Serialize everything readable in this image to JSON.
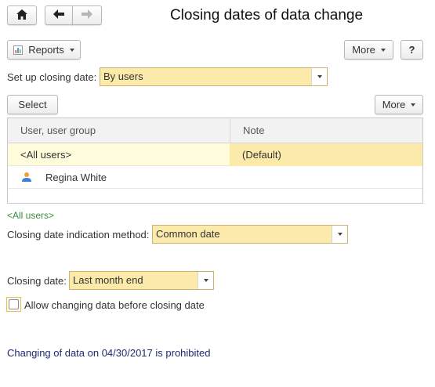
{
  "window": {
    "title": "Closing dates of data change"
  },
  "nav": {
    "home_icon": "home-icon",
    "back_icon": "back-arrow-icon",
    "forward_icon": "forward-arrow-icon"
  },
  "toolbar": {
    "reports_label": "Reports",
    "more_label": "More",
    "help_label": "?"
  },
  "setup": {
    "label": "Set up closing date:",
    "value": "By users"
  },
  "list_toolbar": {
    "select_label": "Select",
    "more_label": "More"
  },
  "table": {
    "columns": [
      "User, user group",
      "Note"
    ],
    "rows": [
      {
        "user": "<All users>",
        "note": "(Default)"
      },
      {
        "user": "Regina White",
        "note": ""
      }
    ]
  },
  "details": {
    "group_link": "<All users>",
    "method_label": "Closing date indication method:",
    "method_value": "Common date",
    "closing_label": "Closing date:",
    "closing_value": "Last month end",
    "allow_label": "Allow changing data before closing date",
    "status_text": "Changing of data on 04/30/2017 is prohibited"
  },
  "colors": {
    "field_fill": "#fbeaaa",
    "selected_row": "#fffcdc",
    "link_green": "#3c8a3c",
    "status_navy": "#1f2a6e"
  }
}
